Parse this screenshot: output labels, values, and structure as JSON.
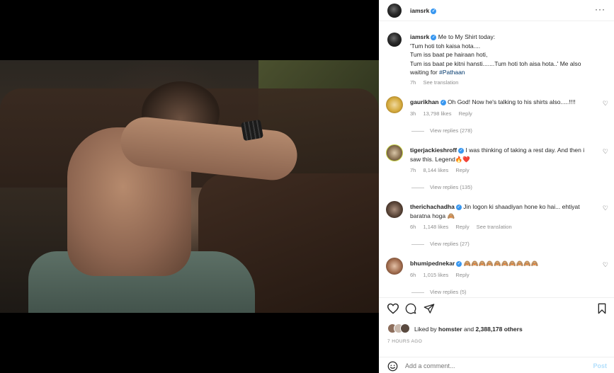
{
  "post": {
    "username": "iamsrk",
    "more_icon": "more-horizontal-icon",
    "caption_user": "iamsrk",
    "caption_lines": [
      "Me to My Shirt today:",
      "'Tum hoti toh kaisa hota....",
      "Tum iss baat pe hairaan hoti,",
      "Tum iss baat pe kitni hansti.......Tum hoti toh aisa hota..' Me also",
      "waiting for"
    ],
    "hashtag": "#Pathaan",
    "caption_time": "7h",
    "see_translation": "See translation"
  },
  "comments": [
    {
      "username": "gaurikhan",
      "text": "Oh God! Now he's talking to his shirts also.....!!!!",
      "time": "3h",
      "likes": "13,798 likes",
      "reply": "Reply",
      "view_replies": "View replies (278)"
    },
    {
      "username": "tigerjackieshroff",
      "text": "I was thinking of taking a rest day. And then i saw this. Legend🔥❤️",
      "time": "7h",
      "likes": "8,144 likes",
      "reply": "Reply",
      "view_replies": "View replies (135)"
    },
    {
      "username": "therichachadha",
      "text": "Jin logon ki shaadiyan hone ko hai... ehtiyat baratna hoga 🙈",
      "time": "6h",
      "likes": "1,148 likes",
      "reply": "Reply",
      "translation": "See translation",
      "view_replies": "View replies (27)"
    },
    {
      "username": "bhumipednekar",
      "text": "🙈🙈🙈🙈🙈🙈🙈🙈🙈🙈",
      "time": "6h",
      "likes": "1,015 likes",
      "reply": "Reply",
      "view_replies": "View replies (5)"
    }
  ],
  "actions": {
    "liked_by_prefix": "Liked by",
    "liked_by_user": "homster",
    "liked_by_and": "and",
    "liked_by_count": "2,388,178 others",
    "timestamp": "7 HOURS AGO",
    "add_comment_placeholder": "Add a comment...",
    "post_label": "Post"
  },
  "colors": {
    "verified": "#3897f0",
    "link": "#00376b",
    "muted": "#8e8e8e",
    "post_disabled": "#b2dffc"
  }
}
